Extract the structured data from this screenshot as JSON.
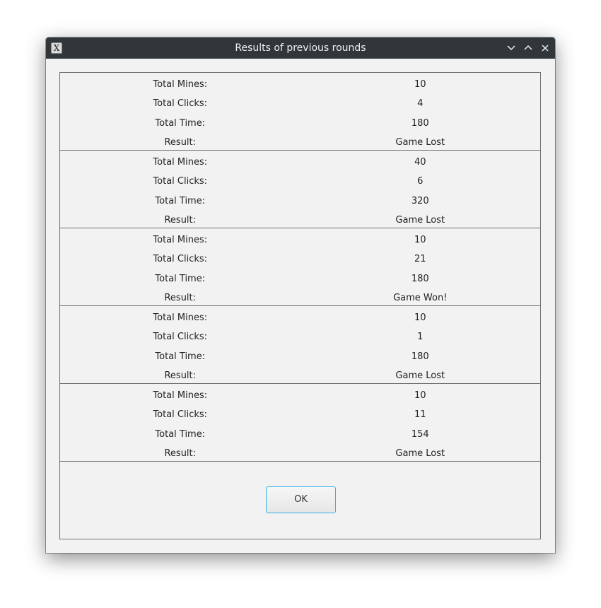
{
  "window": {
    "title": "Results of previous rounds",
    "icon": "app-icon-x"
  },
  "labels": {
    "mines": "Total Mines:",
    "clicks": "Total Clicks:",
    "time": "Total Time:",
    "result": "Result:"
  },
  "rounds": [
    {
      "mines": "10",
      "clicks": "4",
      "time": "180",
      "result": "Game Lost"
    },
    {
      "mines": "40",
      "clicks": "6",
      "time": "320",
      "result": "Game Lost"
    },
    {
      "mines": "10",
      "clicks": "21",
      "time": "180",
      "result": "Game Won!"
    },
    {
      "mines": "10",
      "clicks": "1",
      "time": "180",
      "result": "Game Lost"
    },
    {
      "mines": "10",
      "clicks": "11",
      "time": "154",
      "result": "Game Lost"
    }
  ],
  "ok_label": "OK"
}
